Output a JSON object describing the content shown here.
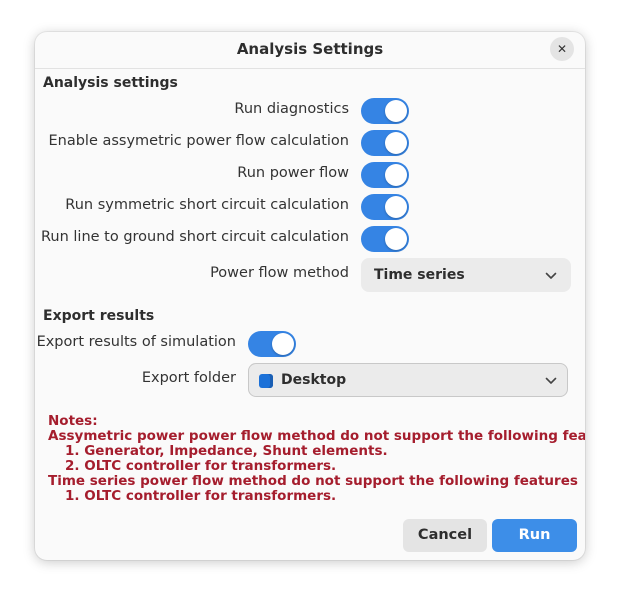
{
  "dialog": {
    "title": "Analysis Settings",
    "close_icon": "close-icon"
  },
  "analysis": {
    "heading": "Analysis settings",
    "toggles": [
      {
        "label": "Run diagnostics",
        "checked": true
      },
      {
        "label": "Enable assymetric power flow calculation",
        "checked": true
      },
      {
        "label": "Run power flow",
        "checked": true
      },
      {
        "label": "Run symmetric short circuit calculation",
        "checked": true
      },
      {
        "label": "Run line to ground short circuit calculation",
        "checked": true
      }
    ],
    "method_label": "Power flow method",
    "method_value": "Time series"
  },
  "export": {
    "heading": "Export results",
    "export_label": "Export results of simulation",
    "export_checked": true,
    "folder_label": "Export folder",
    "folder_value": "Desktop",
    "folder_icon": "folder-icon"
  },
  "notes": {
    "lines": [
      "Notes:",
      "Assymetric power power flow method do not support the following features",
      "1. Generator, Impedance, Shunt elements.",
      "2. OLTC controller for transformers.",
      "Time series power flow method do not support the following features",
      "1. OLTC controller for transformers."
    ]
  },
  "buttons": {
    "cancel": "Cancel",
    "run": "Run"
  },
  "colors": {
    "accent": "#3584e4",
    "run_button": "#3d8ee8",
    "notes_text": "#a51d2d",
    "background": "#fafafa"
  }
}
